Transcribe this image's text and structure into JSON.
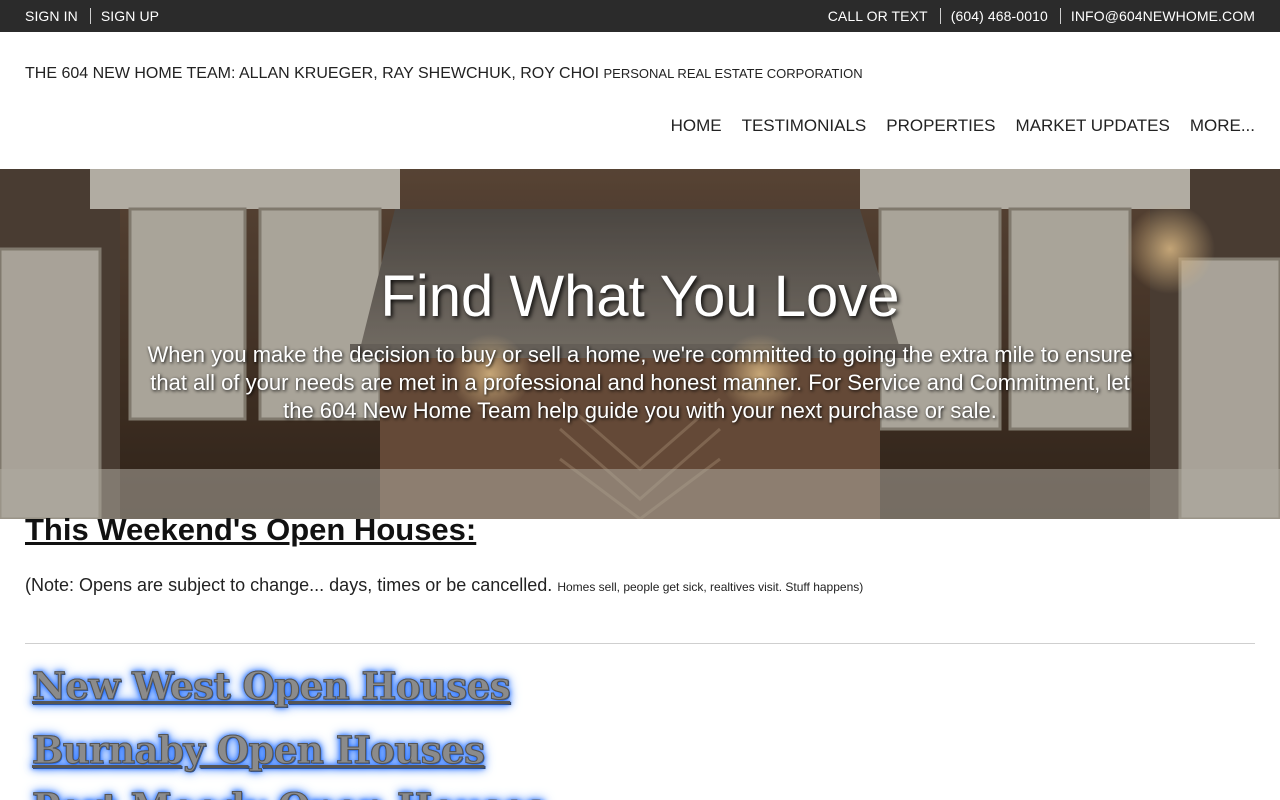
{
  "topbar": {
    "sign_in": "SIGN IN",
    "sign_up": "SIGN UP",
    "call_or_text": "CALL OR TEXT",
    "phone": "(604) 468-0010",
    "email": "INFO@604NEWHOME.COM"
  },
  "brand": {
    "main": "THE 604 NEW HOME TEAM:  ALLAN KRUEGER, RAY SHEWCHUK, ROY CHOI",
    "suffix": "PERSONAL REAL ESTATE CORPORATION"
  },
  "nav": {
    "items": [
      "HOME",
      "TESTIMONIALS",
      "PROPERTIES",
      "MARKET UPDATES",
      "MORE..."
    ]
  },
  "hero": {
    "title": "Find What You Love",
    "text": "When you make the decision to buy or sell a home, we're committed to going the extra mile to ensure that all of your needs are met in a professional and honest manner. For Service and Commitment, let the 604 New Home Team help guide you with your next purchase or sale."
  },
  "content": {
    "section_title": "This Weekend's Open Houses:",
    "note_main": "(Note: Opens are subject to change... days, times or be cancelled.",
    "note_small": "Homes sell, people get sick, realtives visit. Stuff happens)",
    "links": [
      "New West Open Houses",
      "Burnaby Open Houses",
      "Port Moody Open Houses"
    ]
  },
  "colors": {
    "topbar_bg": "#2b2b2b",
    "glow": "#1e6bff"
  }
}
